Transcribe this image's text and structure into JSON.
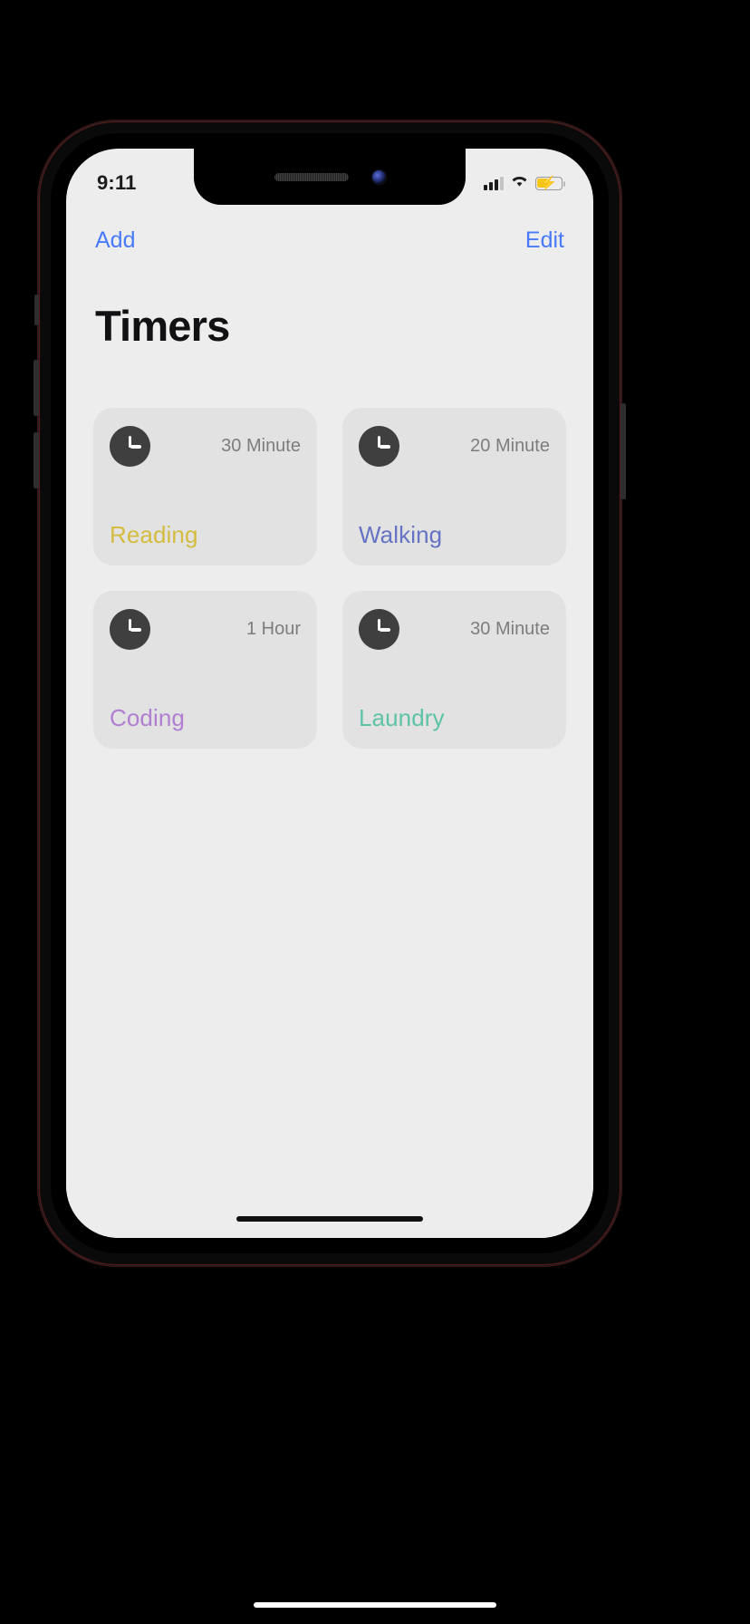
{
  "status_bar": {
    "time": "9:11",
    "signal_icon": "cellular-bars-icon",
    "signal_bars_filled": 3,
    "signal_bars_total": 4,
    "wifi_icon": "wifi-icon",
    "battery_icon": "battery-charging-icon",
    "battery_level_percent": 42,
    "battery_charging": true
  },
  "nav": {
    "add_label": "Add",
    "edit_label": "Edit"
  },
  "header": {
    "title": "Timers"
  },
  "timers": [
    {
      "icon": "clock-icon",
      "duration": "30 Minute",
      "label": "Reading",
      "color": "#d4bc3f"
    },
    {
      "icon": "clock-icon",
      "duration": "20 Minute",
      "label": "Walking",
      "color": "#6573c4"
    },
    {
      "icon": "clock-icon",
      "duration": "1 Hour",
      "label": "Coding",
      "color": "#b07fd1"
    },
    {
      "icon": "clock-icon",
      "duration": "30 Minute",
      "label": "Laundry",
      "color": "#5ec2a6"
    }
  ],
  "colors": {
    "accent_blue": "#4a7afc",
    "screen_background": "#ededed",
    "card_background": "#e2e2e2",
    "duration_text": "#7d7d80",
    "title_text": "#111113",
    "clock_badge": "#3f3f3f"
  },
  "home_indicator": "home-indicator"
}
